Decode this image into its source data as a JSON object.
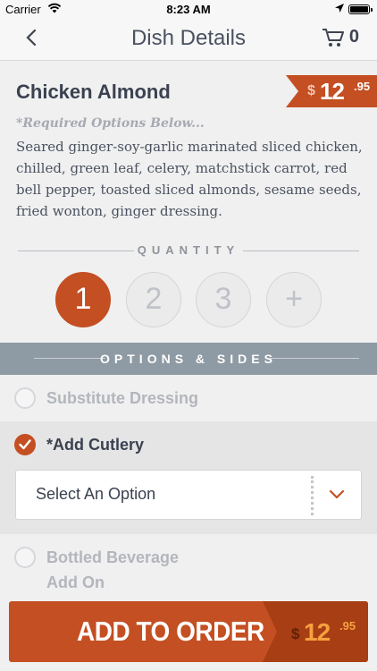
{
  "status_bar": {
    "carrier": "Carrier",
    "time": "8:23 AM"
  },
  "nav": {
    "title": "Dish Details",
    "cart_count": "0"
  },
  "dish": {
    "name": "Chicken Almond",
    "price": {
      "currency": "$",
      "whole": "12",
      "cents": ".95"
    },
    "required_note": "*Required Options Below...",
    "description": "Seared ginger-soy-garlic marinated sliced chicken, chilled, green leaf, celery, matchstick carrot, red bell pepper, toasted sliced almonds, sesame seeds, fried wonton, ginger dressing."
  },
  "quantity": {
    "label": "QUANTITY",
    "options": [
      "1",
      "2",
      "3",
      "+"
    ],
    "selected": "1"
  },
  "options_header": "OPTIONS & SIDES",
  "options": [
    {
      "label": "Substitute Dressing",
      "checked": false
    },
    {
      "label": "*Add Cutlery",
      "checked": true,
      "select_value": "Select An Option"
    },
    {
      "label_line1": "Bottled Beverage",
      "label_line2": "Add On",
      "checked": false
    }
  ],
  "add_button": {
    "label": "ADD TO ORDER",
    "price": {
      "currency": "$",
      "whole": "12",
      "cents": ".95"
    }
  },
  "colors": {
    "accent": "#c44f22",
    "band": "#8e9aa4",
    "price_highlight": "#f5a13f"
  }
}
